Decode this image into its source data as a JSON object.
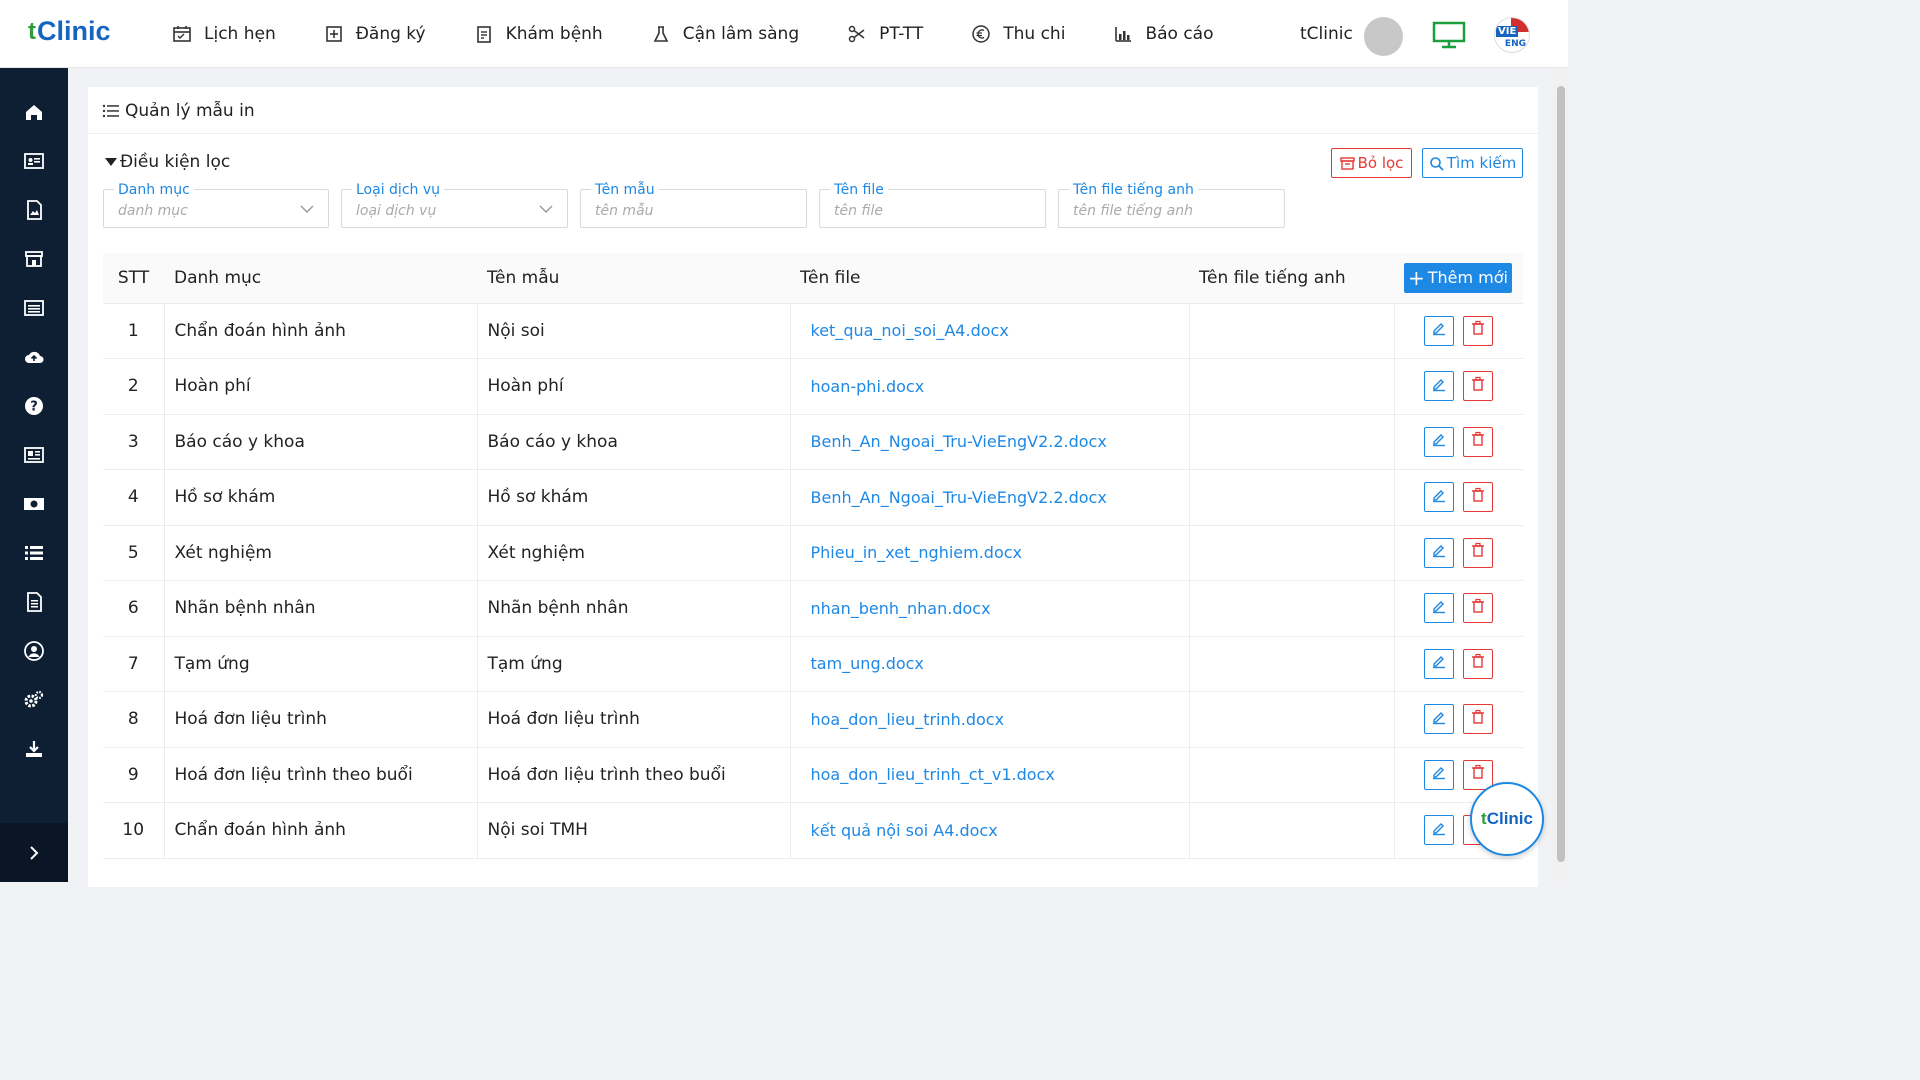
{
  "app": {
    "logo_prefix": "t",
    "logo_text": "Clinic"
  },
  "nav": [
    {
      "label": "Lịch hẹn",
      "icon": "calendar-icon"
    },
    {
      "label": "Đăng ký",
      "icon": "plus-square-icon"
    },
    {
      "label": "Khám bệnh",
      "icon": "clipboard-icon"
    },
    {
      "label": "Cận lâm sàng",
      "icon": "flask-icon"
    },
    {
      "label": "PT-TT",
      "icon": "scissors-icon"
    },
    {
      "label": "Thu chi",
      "icon": "euro-icon"
    },
    {
      "label": "Báo cáo",
      "icon": "bar-chart-icon"
    }
  ],
  "user": {
    "name": "tClinic"
  },
  "language": {
    "primary": "VIE",
    "secondary": "ENG"
  },
  "sidebar_icons": [
    "home-icon",
    "id-card-icon",
    "document-image-icon",
    "store-icon",
    "list-box-icon",
    "cloud-upload-icon",
    "help-icon",
    "newspaper-icon",
    "money-icon",
    "list-icon",
    "file-text-icon",
    "user-circle-icon",
    "settings-icon",
    "download-icon"
  ],
  "page": {
    "title": "Quản lý mẫu in"
  },
  "filter": {
    "title": "Điều kiện lọc",
    "clear_label": "Bỏ lọc",
    "search_label": "Tìm kiếm",
    "fields": [
      {
        "label": "Danh mục",
        "placeholder": "danh mục",
        "type": "select"
      },
      {
        "label": "Loại dịch vụ",
        "placeholder": "loại dịch vụ",
        "type": "select"
      },
      {
        "label": "Tên mẫu",
        "placeholder": "tên mẫu",
        "type": "input"
      },
      {
        "label": "Tên file",
        "placeholder": "tên file",
        "type": "input"
      },
      {
        "label": "Tên file tiếng anh",
        "placeholder": "tên file tiếng anh",
        "type": "input"
      }
    ]
  },
  "table": {
    "headers": {
      "stt": "STT",
      "category": "Danh mục",
      "name": "Tên mẫu",
      "file": "Tên file",
      "file_en": "Tên file tiếng anh"
    },
    "add_label": "Thêm mới",
    "rows": [
      {
        "stt": "1",
        "category": "Chẩn đoán hình ảnh",
        "name": "Nội soi",
        "file": "ket_qua_noi_soi_A4.docx",
        "file_en": ""
      },
      {
        "stt": "2",
        "category": "Hoàn phí",
        "name": "Hoàn phí",
        "file": "hoan-phi.docx",
        "file_en": ""
      },
      {
        "stt": "3",
        "category": "Báo cáo y khoa",
        "name": "Báo cáo y khoa",
        "file": "Benh_An_Ngoai_Tru-VieEngV2.2.docx",
        "file_en": ""
      },
      {
        "stt": "4",
        "category": "Hồ sơ khám",
        "name": "Hồ sơ khám",
        "file": "Benh_An_Ngoai_Tru-VieEngV2.2.docx",
        "file_en": ""
      },
      {
        "stt": "5",
        "category": "Xét nghiệm",
        "name": "Xét nghiệm",
        "file": "Phieu_in_xet_nghiem.docx",
        "file_en": ""
      },
      {
        "stt": "6",
        "category": "Nhãn bệnh nhân",
        "name": "Nhãn bệnh nhân",
        "file": "nhan_benh_nhan.docx",
        "file_en": ""
      },
      {
        "stt": "7",
        "category": "Tạm ứng",
        "name": "Tạm ứng",
        "file": "tam_ung.docx",
        "file_en": ""
      },
      {
        "stt": "8",
        "category": "Hoá đơn liệu trình",
        "name": "Hoá đơn liệu trình",
        "file": "hoa_don_lieu_trinh.docx",
        "file_en": ""
      },
      {
        "stt": "9",
        "category": "Hoá đơn liệu trình theo buổi",
        "name": "Hoá đơn liệu trình theo buổi",
        "file": "hoa_don_lieu_trinh_ct_v1.docx",
        "file_en": ""
      },
      {
        "stt": "10",
        "category": "Chẩn đoán hình ảnh",
        "name": "Nội soi TMH",
        "file": "kết quả nội soi A4.docx",
        "file_en": ""
      }
    ]
  },
  "chat_bubble": {
    "prefix": "t",
    "text": "Clinic"
  },
  "colors": {
    "primary": "#1e88e5",
    "danger": "#e53935",
    "sidebar": "#0f1f33",
    "brand_green": "#2e9c3a",
    "brand_blue": "#1565c0"
  }
}
